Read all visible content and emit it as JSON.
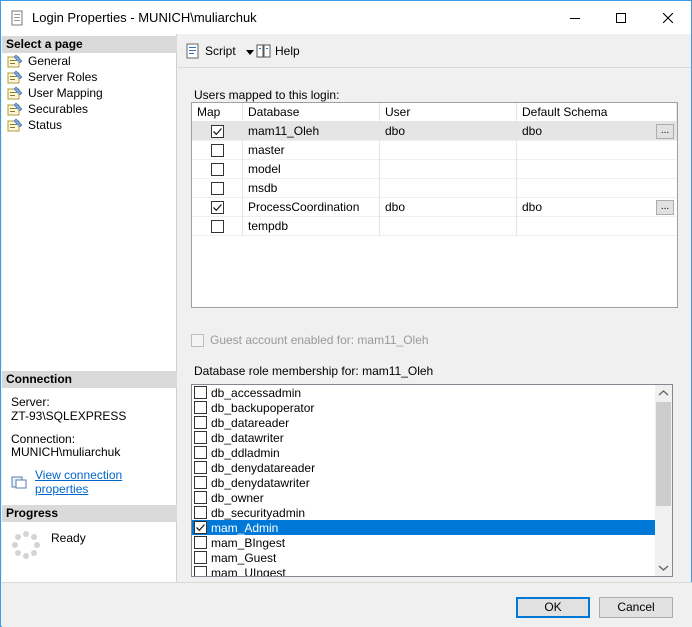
{
  "window": {
    "title": "Login Properties - MUNICH\\muliarchuk"
  },
  "left_panel": {
    "select_page_header": "Select a page",
    "pages": [
      {
        "label": "General",
        "icon": "page-wrench-icon"
      },
      {
        "label": "Server Roles",
        "icon": "page-wrench-icon"
      },
      {
        "label": "User Mapping",
        "icon": "page-wrench-icon"
      },
      {
        "label": "Securables",
        "icon": "page-wrench-icon"
      },
      {
        "label": "Status",
        "icon": "page-wrench-icon"
      }
    ],
    "connection_header": "Connection",
    "server_label": "Server:",
    "server_value": "ZT-93\\SQLEXPRESS",
    "connection_label": "Connection:",
    "connection_value": "MUNICH\\muliarchuk",
    "view_connection_link": "View connection properties",
    "progress_header": "Progress",
    "progress_status": "Ready"
  },
  "toolbar": {
    "script_label": "Script",
    "help_label": "Help"
  },
  "users_mapped": {
    "label": "Users mapped to this login:",
    "columns": [
      "Map",
      "Database",
      "User",
      "Default Schema"
    ],
    "rows": [
      {
        "mapped": true,
        "database": "mam11_Oleh",
        "user": "dbo",
        "schema": "dbo",
        "ellipsis": "...",
        "selected": true
      },
      {
        "mapped": false,
        "database": "master",
        "user": "",
        "schema": "",
        "ellipsis": "",
        "selected": false
      },
      {
        "mapped": false,
        "database": "model",
        "user": "",
        "schema": "",
        "ellipsis": "",
        "selected": false
      },
      {
        "mapped": false,
        "database": "msdb",
        "user": "",
        "schema": "",
        "ellipsis": "",
        "selected": false
      },
      {
        "mapped": true,
        "database": "ProcessCoordination",
        "user": "dbo",
        "schema": "dbo",
        "ellipsis": "...",
        "selected": false
      },
      {
        "mapped": false,
        "database": "tempdb",
        "user": "",
        "schema": "",
        "ellipsis": "",
        "selected": false
      }
    ]
  },
  "guest": {
    "label": "Guest account enabled for: mam11_Oleh",
    "checked": false
  },
  "roles": {
    "label": "Database role membership for: mam11_Oleh",
    "items": [
      {
        "label": "db_accessadmin",
        "checked": false,
        "selected": false
      },
      {
        "label": "db_backupoperator",
        "checked": false,
        "selected": false
      },
      {
        "label": "db_datareader",
        "checked": false,
        "selected": false
      },
      {
        "label": "db_datawriter",
        "checked": false,
        "selected": false
      },
      {
        "label": "db_ddladmin",
        "checked": false,
        "selected": false
      },
      {
        "label": "db_denydatareader",
        "checked": false,
        "selected": false
      },
      {
        "label": "db_denydatawriter",
        "checked": false,
        "selected": false
      },
      {
        "label": "db_owner",
        "checked": false,
        "selected": false
      },
      {
        "label": "db_securityadmin",
        "checked": false,
        "selected": false
      },
      {
        "label": "mam_Admin",
        "checked": true,
        "selected": true
      },
      {
        "label": "mam_BIngest",
        "checked": false,
        "selected": false
      },
      {
        "label": "mam_Guest",
        "checked": false,
        "selected": false
      },
      {
        "label": "mam_UIngest",
        "checked": false,
        "selected": false
      }
    ]
  },
  "footer": {
    "ok_label": "OK",
    "cancel_label": "Cancel"
  },
  "colors": {
    "accent": "#0078d7",
    "window_border": "#3f9ae8",
    "link": "#0066cc"
  }
}
